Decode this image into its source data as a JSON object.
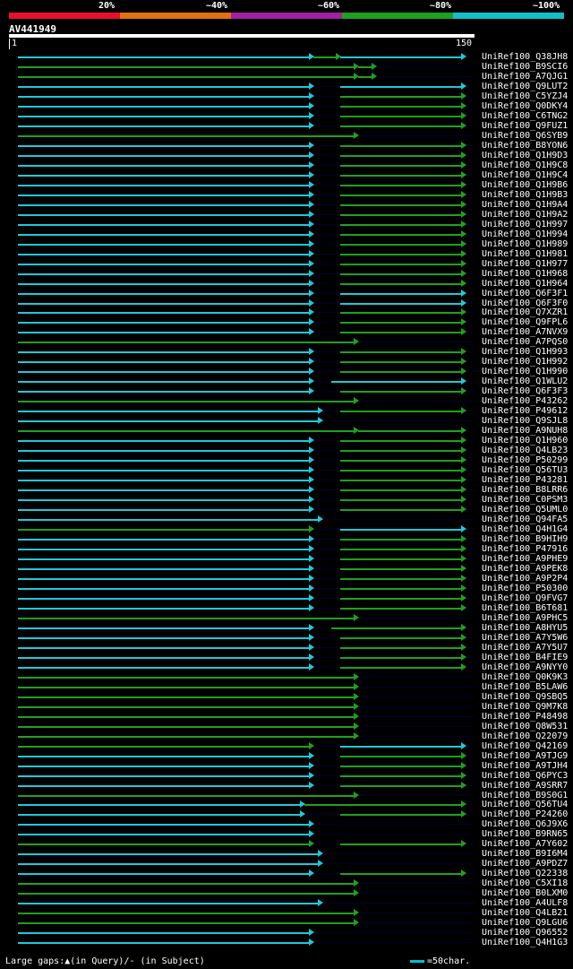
{
  "legend": {
    "labels": [
      "20%",
      "~40%",
      "~60%",
      "~80%",
      "~100%"
    ],
    "colors": [
      "#e8102a",
      "#e07010",
      "#a020a0",
      "#20a020",
      "#10c0c8"
    ]
  },
  "query": {
    "name": "AV441949",
    "start": "1",
    "end": "150"
  },
  "colors": {
    "cyan": "#20c8d8",
    "green": "#20a020",
    "dark": "#000030"
  },
  "hits": [
    {
      "id": "UniRef100_Q38JH8",
      "segs": [
        [
          "c",
          0,
          330
        ],
        [
          "g",
          330,
          360
        ],
        [
          "c",
          360,
          500
        ]
      ]
    },
    {
      "id": "UniRef100_B9SCI6",
      "segs": [
        [
          "g",
          0,
          380
        ],
        [
          "g",
          380,
          400
        ]
      ]
    },
    {
      "id": "UniRef100_A7QJG1",
      "segs": [
        [
          "g",
          0,
          380
        ],
        [
          "g",
          380,
          400
        ]
      ]
    },
    {
      "id": "UniRef100_Q9LUT2",
      "segs": [
        [
          "c",
          0,
          330
        ],
        [
          "c",
          360,
          500
        ]
      ]
    },
    {
      "id": "UniRef100_C5YZJ4",
      "segs": [
        [
          "c",
          0,
          330
        ],
        [
          "g",
          360,
          500
        ]
      ]
    },
    {
      "id": "UniRef100_Q0DKY4",
      "segs": [
        [
          "c",
          0,
          330
        ],
        [
          "g",
          360,
          500
        ]
      ]
    },
    {
      "id": "UniRef100_C6TNG2",
      "segs": [
        [
          "c",
          0,
          330
        ],
        [
          "g",
          360,
          500
        ]
      ]
    },
    {
      "id": "UniRef100_Q9FUZ1",
      "segs": [
        [
          "c",
          0,
          330
        ],
        [
          "g",
          360,
          500
        ]
      ]
    },
    {
      "id": "UniRef100_Q6SYB9",
      "segs": [
        [
          "g",
          0,
          380
        ]
      ]
    },
    {
      "id": "UniRef100_B8YON6",
      "segs": [
        [
          "c",
          0,
          330
        ],
        [
          "g",
          360,
          500
        ]
      ]
    },
    {
      "id": "UniRef100_Q1H9D3",
      "segs": [
        [
          "c",
          0,
          330
        ],
        [
          "g",
          360,
          500
        ]
      ]
    },
    {
      "id": "UniRef100_Q1H9C8",
      "segs": [
        [
          "c",
          0,
          330
        ],
        [
          "g",
          360,
          500
        ]
      ]
    },
    {
      "id": "UniRef100_Q1H9C4",
      "segs": [
        [
          "c",
          0,
          330
        ],
        [
          "g",
          360,
          500
        ]
      ]
    },
    {
      "id": "UniRef100_Q1H9B6",
      "segs": [
        [
          "c",
          0,
          330
        ],
        [
          "g",
          360,
          500
        ]
      ]
    },
    {
      "id": "UniRef100_Q1H9B3",
      "segs": [
        [
          "c",
          0,
          330
        ],
        [
          "g",
          360,
          500
        ]
      ]
    },
    {
      "id": "UniRef100_Q1H9A4",
      "segs": [
        [
          "c",
          0,
          330
        ],
        [
          "g",
          360,
          500
        ]
      ]
    },
    {
      "id": "UniRef100_Q1H9A2",
      "segs": [
        [
          "c",
          0,
          330
        ],
        [
          "g",
          360,
          500
        ]
      ]
    },
    {
      "id": "UniRef100_Q1H997",
      "segs": [
        [
          "c",
          0,
          330
        ],
        [
          "g",
          360,
          500
        ]
      ]
    },
    {
      "id": "UniRef100_Q1H994",
      "segs": [
        [
          "c",
          0,
          330
        ],
        [
          "g",
          360,
          500
        ]
      ]
    },
    {
      "id": "UniRef100_Q1H989",
      "segs": [
        [
          "c",
          0,
          330
        ],
        [
          "g",
          360,
          500
        ]
      ]
    },
    {
      "id": "UniRef100_Q1H981",
      "segs": [
        [
          "c",
          0,
          330
        ],
        [
          "g",
          360,
          500
        ]
      ]
    },
    {
      "id": "UniRef100_Q1H977",
      "segs": [
        [
          "c",
          0,
          330
        ],
        [
          "g",
          360,
          500
        ]
      ]
    },
    {
      "id": "UniRef100_Q1H968",
      "segs": [
        [
          "c",
          0,
          330
        ],
        [
          "g",
          360,
          500
        ]
      ]
    },
    {
      "id": "UniRef100_Q1H964",
      "segs": [
        [
          "c",
          0,
          330
        ],
        [
          "g",
          360,
          500
        ]
      ]
    },
    {
      "id": "UniRef100_Q6F3F1",
      "segs": [
        [
          "c",
          0,
          330
        ],
        [
          "c",
          360,
          500
        ]
      ]
    },
    {
      "id": "UniRef100_Q6F3F0",
      "segs": [
        [
          "c",
          0,
          330
        ],
        [
          "c",
          360,
          500
        ]
      ]
    },
    {
      "id": "UniRef100_Q7XZR1",
      "segs": [
        [
          "c",
          0,
          330
        ],
        [
          "g",
          360,
          500
        ]
      ]
    },
    {
      "id": "UniRef100_Q9FPL6",
      "segs": [
        [
          "c",
          0,
          330
        ],
        [
          "g",
          360,
          500
        ]
      ]
    },
    {
      "id": "UniRef100_A7NVX9",
      "segs": [
        [
          "c",
          0,
          330
        ],
        [
          "g",
          360,
          500
        ]
      ]
    },
    {
      "id": "UniRef100_A7PQS0",
      "segs": [
        [
          "g",
          0,
          380
        ]
      ]
    },
    {
      "id": "UniRef100_Q1H993",
      "segs": [
        [
          "c",
          0,
          330
        ],
        [
          "g",
          360,
          500
        ]
      ]
    },
    {
      "id": "UniRef100_Q1H992",
      "segs": [
        [
          "c",
          0,
          330
        ],
        [
          "g",
          360,
          500
        ]
      ]
    },
    {
      "id": "UniRef100_Q1H990",
      "segs": [
        [
          "c",
          0,
          330
        ],
        [
          "g",
          360,
          500
        ]
      ]
    },
    {
      "id": "UniRef100_Q1WLU2",
      "segs": [
        [
          "c",
          0,
          330
        ],
        [
          "c",
          350,
          500
        ]
      ]
    },
    {
      "id": "UniRef100_Q6F3F3",
      "segs": [
        [
          "c",
          0,
          330
        ],
        [
          "g",
          360,
          500
        ]
      ]
    },
    {
      "id": "UniRef100_P43262",
      "segs": [
        [
          "g",
          0,
          380
        ]
      ]
    },
    {
      "id": "UniRef100_P49612",
      "segs": [
        [
          "c",
          0,
          340
        ],
        [
          "g",
          360,
          500
        ]
      ]
    },
    {
      "id": "UniRef100_Q9SJL8",
      "segs": [
        [
          "c",
          0,
          340
        ]
      ]
    },
    {
      "id": "UniRef100_A9NUH8",
      "segs": [
        [
          "g",
          0,
          380
        ],
        [
          "g",
          380,
          500
        ]
      ]
    },
    {
      "id": "UniRef100_Q1H960",
      "segs": [
        [
          "c",
          0,
          330
        ],
        [
          "g",
          360,
          500
        ]
      ]
    },
    {
      "id": "UniRef100_Q4LB23",
      "segs": [
        [
          "c",
          0,
          330
        ],
        [
          "g",
          360,
          500
        ]
      ]
    },
    {
      "id": "UniRef100_P50299",
      "segs": [
        [
          "c",
          0,
          330
        ],
        [
          "g",
          360,
          500
        ]
      ]
    },
    {
      "id": "UniRef100_Q56TU3",
      "segs": [
        [
          "c",
          0,
          330
        ],
        [
          "g",
          360,
          500
        ]
      ]
    },
    {
      "id": "UniRef100_P43281",
      "segs": [
        [
          "c",
          0,
          330
        ],
        [
          "g",
          360,
          500
        ]
      ]
    },
    {
      "id": "UniRef100_B8LRR6",
      "segs": [
        [
          "c",
          0,
          330
        ],
        [
          "g",
          360,
          500
        ]
      ]
    },
    {
      "id": "UniRef100_C0PSM3",
      "segs": [
        [
          "c",
          0,
          330
        ],
        [
          "g",
          360,
          500
        ]
      ]
    },
    {
      "id": "UniRef100_Q5UML0",
      "segs": [
        [
          "c",
          0,
          330
        ],
        [
          "g",
          360,
          500
        ]
      ]
    },
    {
      "id": "UniRef100_Q94FA5",
      "segs": [
        [
          "c",
          0,
          340
        ]
      ]
    },
    {
      "id": "UniRef100_Q4H1G4",
      "segs": [
        [
          "g",
          0,
          330
        ],
        [
          "c",
          360,
          500
        ]
      ]
    },
    {
      "id": "UniRef100_B9HIH9",
      "segs": [
        [
          "c",
          0,
          330
        ],
        [
          "g",
          360,
          500
        ]
      ]
    },
    {
      "id": "UniRef100_P47916",
      "segs": [
        [
          "c",
          0,
          330
        ],
        [
          "g",
          360,
          500
        ]
      ]
    },
    {
      "id": "UniRef100_A9PHE9",
      "segs": [
        [
          "c",
          0,
          330
        ],
        [
          "g",
          360,
          500
        ]
      ]
    },
    {
      "id": "UniRef100_A9PEK8",
      "segs": [
        [
          "c",
          0,
          330
        ],
        [
          "g",
          360,
          500
        ]
      ]
    },
    {
      "id": "UniRef100_A9P2P4",
      "segs": [
        [
          "c",
          0,
          330
        ],
        [
          "g",
          360,
          500
        ]
      ]
    },
    {
      "id": "UniRef100_P50300",
      "segs": [
        [
          "c",
          0,
          330
        ],
        [
          "g",
          360,
          500
        ]
      ]
    },
    {
      "id": "UniRef100_Q9FVG7",
      "segs": [
        [
          "c",
          0,
          330
        ],
        [
          "g",
          360,
          500
        ]
      ]
    },
    {
      "id": "UniRef100_B6T681",
      "segs": [
        [
          "c",
          0,
          330
        ],
        [
          "g",
          360,
          500
        ]
      ]
    },
    {
      "id": "UniRef100_A9PHC5",
      "segs": [
        [
          "g",
          0,
          380
        ]
      ]
    },
    {
      "id": "UniRef100_A8HYU5",
      "segs": [
        [
          "c",
          0,
          330
        ],
        [
          "g",
          350,
          500
        ]
      ]
    },
    {
      "id": "UniRef100_A7Y5W6",
      "segs": [
        [
          "c",
          0,
          330
        ],
        [
          "g",
          360,
          500
        ]
      ]
    },
    {
      "id": "UniRef100_A7Y5U7",
      "segs": [
        [
          "c",
          0,
          330
        ],
        [
          "g",
          360,
          500
        ]
      ]
    },
    {
      "id": "UniRef100_B4FIE9",
      "segs": [
        [
          "c",
          0,
          330
        ],
        [
          "g",
          360,
          500
        ]
      ]
    },
    {
      "id": "UniRef100_A9NYY0",
      "segs": [
        [
          "c",
          0,
          330
        ],
        [
          "g",
          360,
          500
        ]
      ]
    },
    {
      "id": "UniRef100_Q0K9K3",
      "segs": [
        [
          "g",
          0,
          380
        ]
      ]
    },
    {
      "id": "UniRef100_B5LAW6",
      "segs": [
        [
          "g",
          0,
          380
        ]
      ]
    },
    {
      "id": "UniRef100_Q9SBQ5",
      "segs": [
        [
          "g",
          0,
          380
        ]
      ]
    },
    {
      "id": "UniRef100_Q9M7K8",
      "segs": [
        [
          "g",
          0,
          380
        ]
      ]
    },
    {
      "id": "UniRef100_P48498",
      "segs": [
        [
          "g",
          0,
          380
        ]
      ]
    },
    {
      "id": "UniRef100_Q8W531",
      "segs": [
        [
          "g",
          0,
          380
        ]
      ]
    },
    {
      "id": "UniRef100_Q22079",
      "segs": [
        [
          "g",
          0,
          380
        ]
      ]
    },
    {
      "id": "UniRef100_Q42169",
      "segs": [
        [
          "g",
          0,
          330
        ],
        [
          "c",
          360,
          500
        ]
      ]
    },
    {
      "id": "UniRef100_A9TJG9",
      "segs": [
        [
          "c",
          0,
          330
        ],
        [
          "g",
          360,
          500
        ]
      ]
    },
    {
      "id": "UniRef100_A9TJH4",
      "segs": [
        [
          "c",
          0,
          330
        ],
        [
          "g",
          360,
          500
        ]
      ]
    },
    {
      "id": "UniRef100_Q6PYC3",
      "segs": [
        [
          "c",
          0,
          330
        ],
        [
          "g",
          360,
          500
        ]
      ]
    },
    {
      "id": "UniRef100_A9SRR7",
      "segs": [
        [
          "c",
          0,
          330
        ],
        [
          "g",
          360,
          500
        ]
      ]
    },
    {
      "id": "UniRef100_B9S0G1",
      "segs": [
        [
          "g",
          0,
          380
        ]
      ]
    },
    {
      "id": "UniRef100_Q56TU4",
      "segs": [
        [
          "c",
          0,
          320
        ],
        [
          "g",
          320,
          500
        ]
      ]
    },
    {
      "id": "UniRef100_P24260",
      "segs": [
        [
          "c",
          0,
          320
        ],
        [
          "g",
          360,
          500
        ]
      ]
    },
    {
      "id": "UniRef100_Q6J9X6",
      "segs": [
        [
          "c",
          0,
          330
        ]
      ]
    },
    {
      "id": "UniRef100_B9RN65",
      "segs": [
        [
          "c",
          0,
          330
        ]
      ]
    },
    {
      "id": "UniRef100_A7Y602",
      "segs": [
        [
          "g",
          0,
          330
        ],
        [
          "g",
          360,
          500
        ]
      ]
    },
    {
      "id": "UniRef100_B9I6M4",
      "segs": [
        [
          "c",
          0,
          340
        ]
      ]
    },
    {
      "id": "UniRef100_A9PDZ7",
      "segs": [
        [
          "c",
          0,
          340
        ]
      ]
    },
    {
      "id": "UniRef100_Q22338",
      "segs": [
        [
          "c",
          0,
          330
        ],
        [
          "g",
          360,
          500
        ]
      ]
    },
    {
      "id": "UniRef100_C5XI18",
      "segs": [
        [
          "g",
          0,
          380
        ]
      ]
    },
    {
      "id": "UniRef100_B0LXM0",
      "segs": [
        [
          "g",
          0,
          380
        ]
      ]
    },
    {
      "id": "UniRef100_A4ULF8",
      "segs": [
        [
          "c",
          0,
          340
        ]
      ]
    },
    {
      "id": "UniRef100_Q4LB21",
      "segs": [
        [
          "g",
          0,
          380
        ]
      ]
    },
    {
      "id": "UniRef100_Q9LGU6",
      "segs": [
        [
          "g",
          0,
          380
        ]
      ]
    },
    {
      "id": "UniRef100_Q96552",
      "segs": [
        [
          "c",
          0,
          330
        ]
      ]
    },
    {
      "id": "UniRef100_Q4H1G3",
      "segs": [
        [
          "c",
          0,
          330
        ]
      ]
    }
  ],
  "footer": {
    "gaps": "Large gaps:▲(in Query)/‑ (in Subject)",
    "scale": "=50char."
  }
}
